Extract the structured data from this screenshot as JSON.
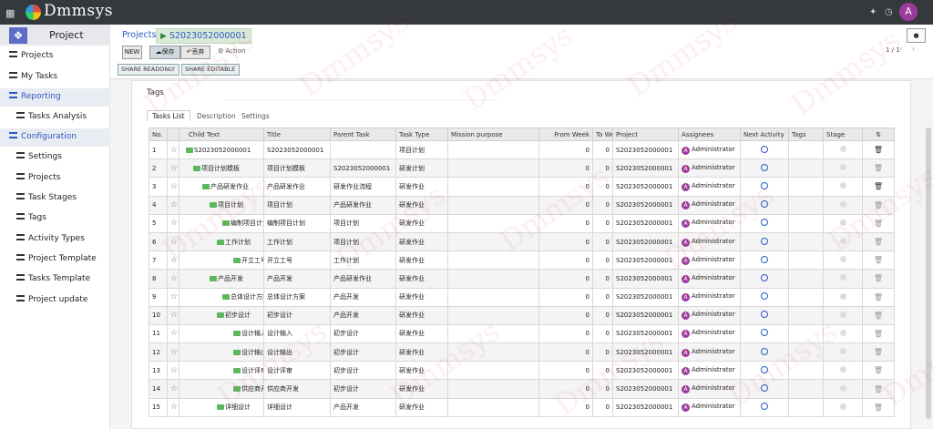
{
  "app": {
    "brand": "Dmmsys",
    "module": "Project",
    "user_initial": "A"
  },
  "sidebar": {
    "items": [
      {
        "label": "Projects",
        "indent": false,
        "active": false
      },
      {
        "label": "My Tasks",
        "indent": false,
        "active": false
      },
      {
        "label": "Reporting",
        "indent": false,
        "active": true
      },
      {
        "label": "Tasks Analysis",
        "indent": true,
        "active": false
      },
      {
        "label": "Configuration",
        "indent": false,
        "active": true
      },
      {
        "label": "Settings",
        "indent": true,
        "active": false
      },
      {
        "label": "Projects",
        "indent": true,
        "active": false
      },
      {
        "label": "Task Stages",
        "indent": true,
        "active": false
      },
      {
        "label": "Tags",
        "indent": true,
        "active": false
      },
      {
        "label": "Activity Types",
        "indent": true,
        "active": false
      },
      {
        "label": "Project Template",
        "indent": true,
        "active": false
      },
      {
        "label": "Tasks Template",
        "indent": true,
        "active": false
      },
      {
        "label": "Project update",
        "indent": true,
        "active": false
      }
    ]
  },
  "breadcrumb": {
    "parent": "Projects",
    "current": "S2023052000001"
  },
  "toolbar": {
    "new_label": "NEW",
    "save_label": "保存",
    "discard_label": "丢弃",
    "action_label": "Action",
    "pager": "1 / 1",
    "share_readonly": "SHARE READONLY",
    "share_editable": "SHARE EDITABLE"
  },
  "form": {
    "tags_label": "Tags",
    "tabs": [
      "Tasks List",
      "Description",
      "Settings"
    ],
    "columns": [
      "No.",
      "",
      "Child Text",
      "Title",
      "Parent Task",
      "Task Type",
      "Mission purpose",
      "From Week",
      "To Week",
      "Project",
      "Assignees",
      "Next Activity",
      "Tags",
      "Stage",
      ""
    ],
    "rows": [
      {
        "no": "1",
        "child": "S2023052000001",
        "title": "S2023052000001",
        "parent": "",
        "type": "项目计划",
        "from": "0",
        "to": "0",
        "project": "S2023052000001",
        "assignee": "Administrator"
      },
      {
        "no": "2",
        "child": "项目计划模板",
        "title": "项目计划模板",
        "parent": "S2023052000001",
        "type": "研发计划",
        "from": "0",
        "to": "0",
        "project": "S2023052000001",
        "assignee": "Administrator"
      },
      {
        "no": "3",
        "child": "产品研发作业",
        "title": "产品研发作业",
        "parent": "研发作业流程",
        "type": "研发作业",
        "from": "0",
        "to": "0",
        "project": "S2023052000001",
        "assignee": "Administrator"
      },
      {
        "no": "4",
        "child": "项目计划",
        "title": "项目计划",
        "parent": "产品研发作业",
        "type": "研发作业",
        "from": "0",
        "to": "0",
        "project": "S2023052000001",
        "assignee": "Administrator"
      },
      {
        "no": "5",
        "child": "编制项目计划",
        "title": "编制项目计划",
        "parent": "项目计划",
        "type": "研发作业",
        "from": "0",
        "to": "0",
        "project": "S2023052000001",
        "assignee": "Administrator"
      },
      {
        "no": "6",
        "child": "工作计划",
        "title": "工作计划",
        "parent": "项目计划",
        "type": "研发作业",
        "from": "0",
        "to": "0",
        "project": "S2023052000001",
        "assignee": "Administrator"
      },
      {
        "no": "7",
        "child": "开立工号",
        "title": "开立工号",
        "parent": "工作计划",
        "type": "研发作业",
        "from": "0",
        "to": "0",
        "project": "S2023052000001",
        "assignee": "Administrator"
      },
      {
        "no": "8",
        "child": "产品开发",
        "title": "产品开发",
        "parent": "产品研发作业",
        "type": "研发作业",
        "from": "0",
        "to": "0",
        "project": "S2023052000001",
        "assignee": "Administrator"
      },
      {
        "no": "9",
        "child": "总体设计方案",
        "title": "总体设计方案",
        "parent": "产品开发",
        "type": "研发作业",
        "from": "0",
        "to": "0",
        "project": "S2023052000001",
        "assignee": "Administrator"
      },
      {
        "no": "10",
        "child": "初步设计",
        "title": "初步设计",
        "parent": "产品开发",
        "type": "研发作业",
        "from": "0",
        "to": "0",
        "project": "S2023052000001",
        "assignee": "Administrator"
      },
      {
        "no": "11",
        "child": "设计输入",
        "title": "设计输入",
        "parent": "初步设计",
        "type": "研发作业",
        "from": "0",
        "to": "0",
        "project": "S2023052000001",
        "assignee": "Administrator"
      },
      {
        "no": "12",
        "child": "设计输出",
        "title": "设计输出",
        "parent": "初步设计",
        "type": "研发作业",
        "from": "0",
        "to": "0",
        "project": "S2023052000001",
        "assignee": "Administrator"
      },
      {
        "no": "13",
        "child": "设计评审",
        "title": "设计评审",
        "parent": "初步设计",
        "type": "研发作业",
        "from": "0",
        "to": "0",
        "project": "S2023052000001",
        "assignee": "Administrator"
      },
      {
        "no": "14",
        "child": "供应商开发",
        "title": "供应商开发",
        "parent": "初步设计",
        "type": "研发作业",
        "from": "0",
        "to": "0",
        "project": "S2023052000001",
        "assignee": "Administrator"
      },
      {
        "no": "15",
        "child": "详细设计",
        "title": "详细设计",
        "parent": "产品开发",
        "type": "研发作业",
        "from": "0",
        "to": "0",
        "project": "S2023052000001",
        "assignee": "Administrator"
      }
    ]
  },
  "watermark": "Dmmsys"
}
